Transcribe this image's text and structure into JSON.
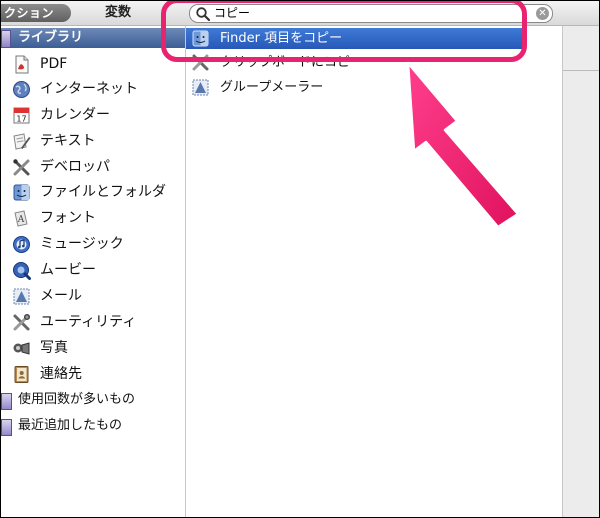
{
  "toolbar": {
    "actions_label": "アクション",
    "actions_visible": "クション",
    "variables_label": "変数"
  },
  "search": {
    "value": "コピー",
    "clear_icon": "clear-search-icon"
  },
  "library": {
    "header": "ライブラリ",
    "items": [
      {
        "label": "PDF",
        "icon": "pdf-icon"
      },
      {
        "label": "インターネット",
        "icon": "internet-globe-icon"
      },
      {
        "label": "カレンダー",
        "icon": "calendar-icon"
      },
      {
        "label": "テキスト",
        "icon": "text-pen-icon"
      },
      {
        "label": "デベロッパ",
        "icon": "developer-tools-icon"
      },
      {
        "label": "ファイルとフォルダ",
        "icon": "finder-icon"
      },
      {
        "label": "フォント",
        "icon": "font-icon"
      },
      {
        "label": "ミュージック",
        "icon": "music-icon"
      },
      {
        "label": "ムービー",
        "icon": "movie-icon"
      },
      {
        "label": "メール",
        "icon": "mail-stamp-icon"
      },
      {
        "label": "ユーティリティ",
        "icon": "utilities-icon"
      },
      {
        "label": "写真",
        "icon": "photo-icon"
      },
      {
        "label": "連絡先",
        "icon": "contacts-icon"
      }
    ],
    "smart_groups": [
      {
        "label": "使用回数が多いもの",
        "icon": "smart-group-icon"
      },
      {
        "label": "最近追加したもの",
        "icon": "smart-group-icon"
      }
    ]
  },
  "results": {
    "items": [
      {
        "label": "Finder 項目をコピー",
        "icon": "finder-icon",
        "selected": true
      },
      {
        "label": "クリップボードにコピー",
        "icon": "utilities-icon",
        "selected": false
      },
      {
        "label": "グループメーラー",
        "icon": "mail-stamp-icon",
        "selected": false
      }
    ]
  },
  "colors": {
    "annotation": "#e8236f",
    "selection": "#3468c6",
    "library_header": "#4b6aa3"
  }
}
